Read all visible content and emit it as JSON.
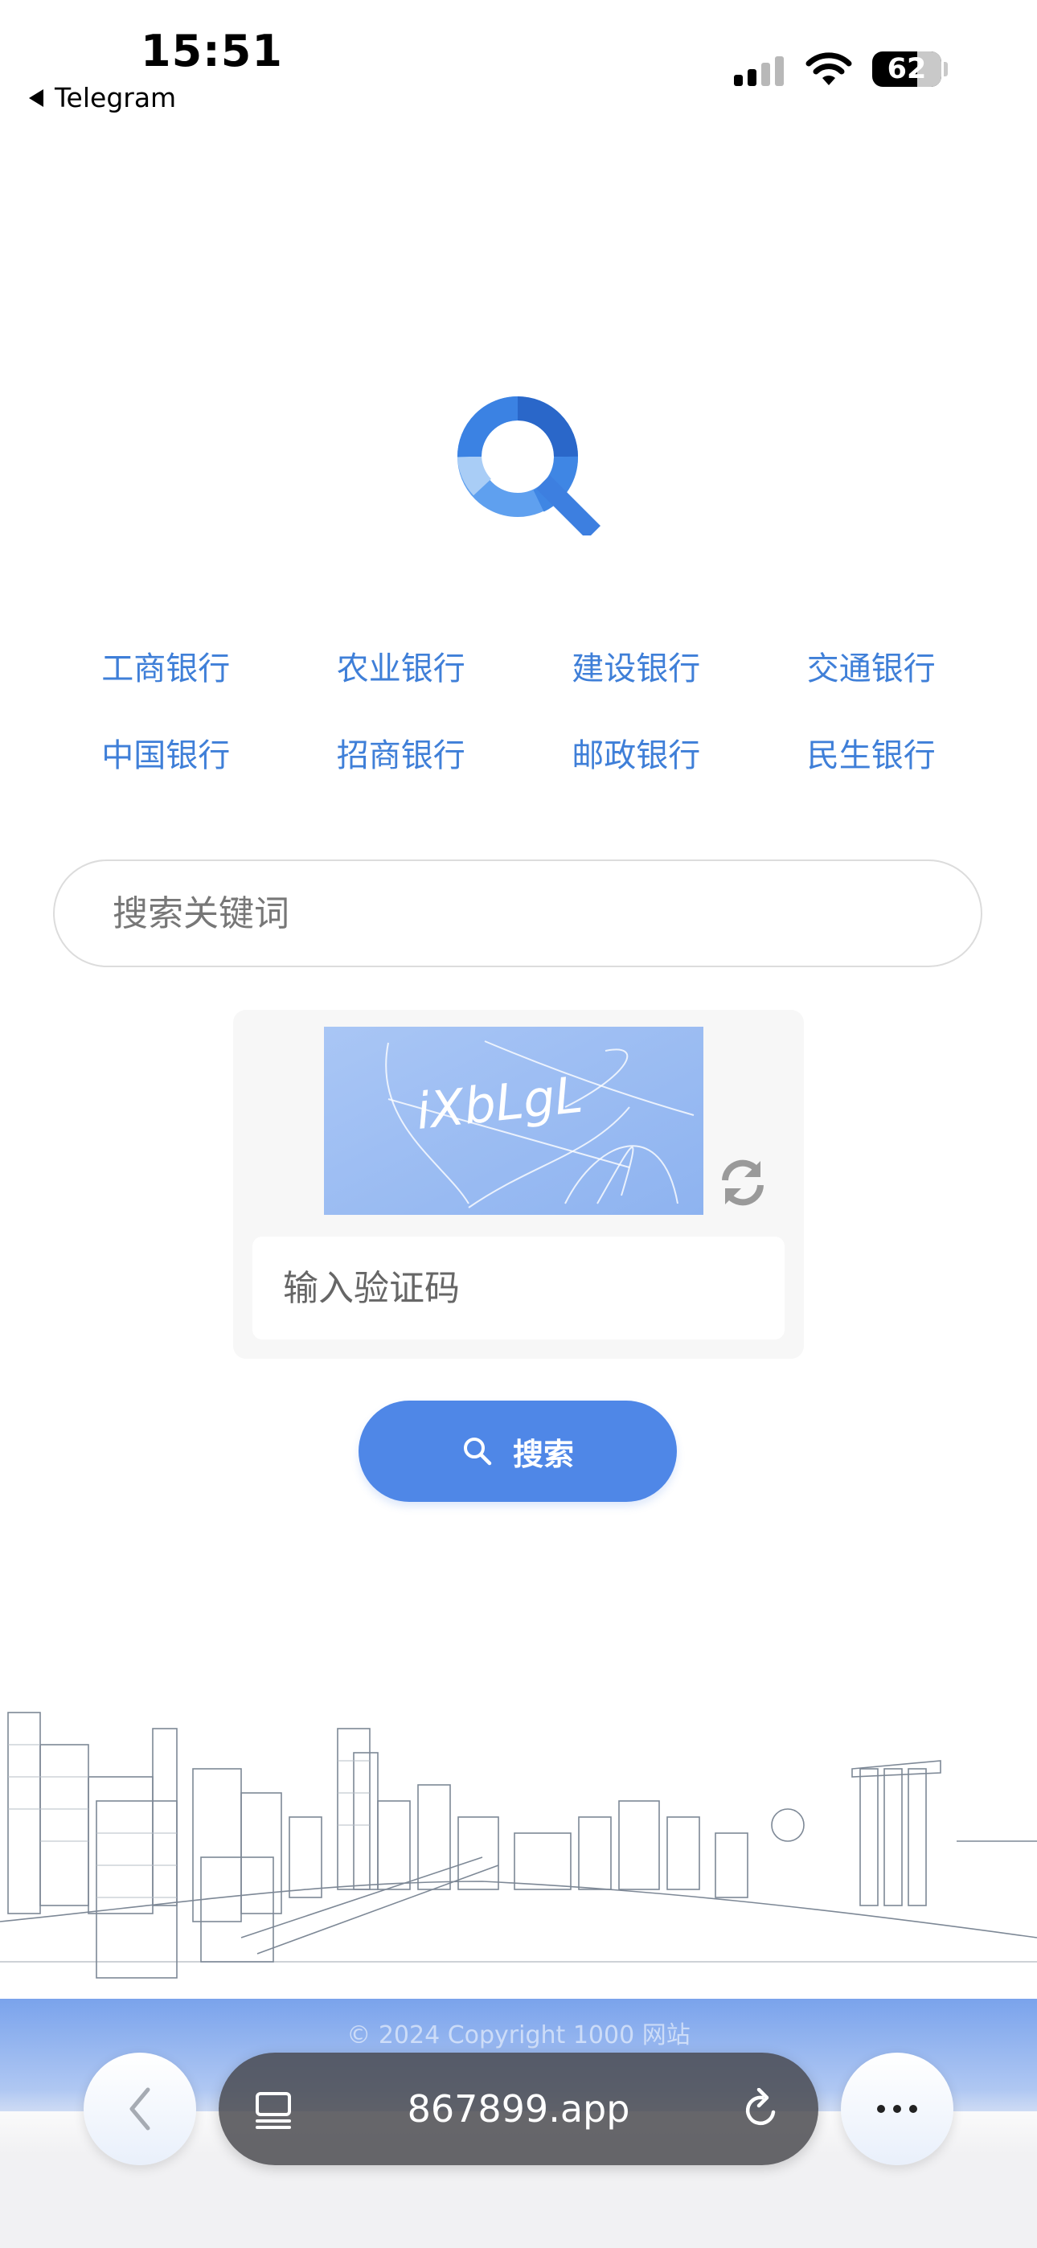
{
  "status_bar": {
    "time": "15:51",
    "back_app": "Telegram",
    "battery": "62",
    "icons": [
      "back-arrow-icon",
      "signal-icon",
      "wifi-icon",
      "battery-icon"
    ]
  },
  "logo": {
    "icon": "search-magnifier-logo"
  },
  "banks": [
    "工商银行",
    "农业银行",
    "建设银行",
    "交通银行",
    "中国银行",
    "招商银行",
    "邮政银行",
    "民生银行"
  ],
  "search": {
    "placeholder": "搜索关键词",
    "value": ""
  },
  "captcha": {
    "code": "iXbLgL",
    "placeholder": "输入验证码",
    "refresh_icon": "refresh-icon"
  },
  "search_button": {
    "label": "搜索",
    "icon": "search-icon"
  },
  "footer": {
    "text": "© 2024 Copyright 1000 网站"
  },
  "browser": {
    "url": "867899.app",
    "back_icon": "chevron-left-icon",
    "tabs_icon": "tabs-icon",
    "reload_icon": "reload-icon",
    "more_icon": "more-dots-icon"
  },
  "colors": {
    "accent": "#4f87e7",
    "link": "#3f7fd8",
    "captcha_bg": "#9bbcf3"
  }
}
